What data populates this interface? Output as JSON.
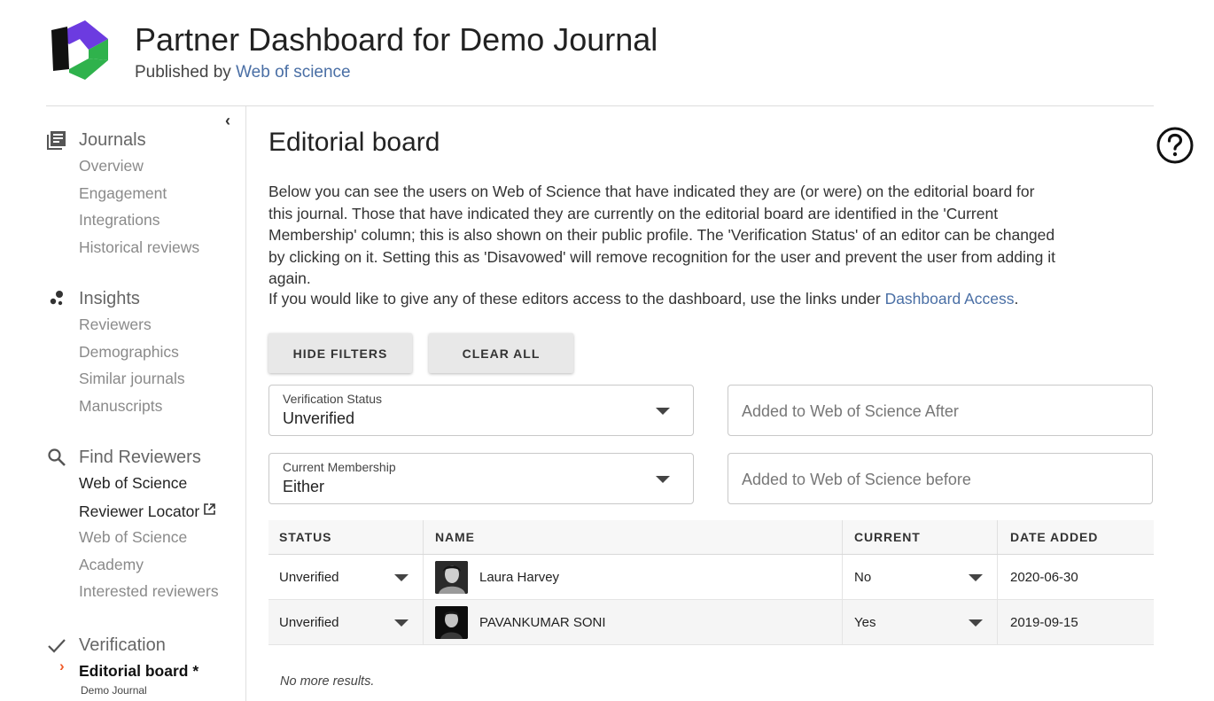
{
  "header": {
    "title": "Partner Dashboard for Demo Journal",
    "published_prefix": "Published by",
    "publisher": "Web of science"
  },
  "sidebar": {
    "collapse_icon": "chevron-left-icon",
    "sections": [
      {
        "title": "Journals",
        "icon": "journals-icon",
        "items": [
          "Overview",
          "Engagement",
          "Integrations",
          "Historical reviews"
        ]
      },
      {
        "title": "Insights",
        "icon": "insights-icon",
        "items": [
          "Reviewers",
          "Demographics",
          "Similar journals",
          "Manuscripts"
        ]
      },
      {
        "title": "Find Reviewers",
        "icon": "search-icon",
        "items": [
          "Web of Science",
          "Reviewer Locator",
          "Web of Science",
          "Academy",
          "Interested reviewers"
        ]
      },
      {
        "title": "Verification",
        "icon": "check-icon",
        "selected_item": "Editorial board *",
        "selected_sub": "Demo Journal"
      }
    ]
  },
  "main": {
    "page_title": "Editorial board",
    "description": "Below you can see the users on Web of Science that have indicated they are (or were) on the editorial board for this journal. Those that have indicated they are currently on the editorial board are identified in the 'Current Membership' column; this is also shown on their public profile. The 'Verification Status' of an editor can be changed by clicking on it. Setting this as 'Disavowed' will remove recognition for the user and prevent the user from adding it again.",
    "access_text": "If you would like to give any of these editors access to the dashboard, use the links under",
    "access_link": "Dashboard Access",
    "access_suffix": ".",
    "buttons": {
      "hide_filters": "HIDE FILTERS",
      "clear_all": "CLEAR ALL"
    },
    "filters": {
      "verification_status": {
        "label": "Verification Status",
        "value": "Unverified"
      },
      "current_membership": {
        "label": "Current Membership",
        "value": "Either"
      },
      "added_after": {
        "placeholder": "Added to Web of Science After"
      },
      "added_before": {
        "placeholder": "Added to Web of Science before"
      }
    },
    "table": {
      "columns": [
        "STATUS",
        "NAME",
        "CURRENT",
        "DATE ADDED"
      ],
      "rows": [
        {
          "status": "Unverified",
          "name": "Laura Harvey",
          "current": "No",
          "date_added": "2020-06-30"
        },
        {
          "status": "Unverified",
          "name": "PAVANKUMAR SONI",
          "current": "Yes",
          "date_added": "2019-09-15"
        }
      ]
    },
    "no_more": "No more results."
  },
  "help_icon": "help-circle-icon",
  "colors": {
    "link": "#4a6fa5",
    "selected_chevron": "#f05a28",
    "logo_purple": "#6c3be0",
    "logo_green": "#2fb24c"
  }
}
